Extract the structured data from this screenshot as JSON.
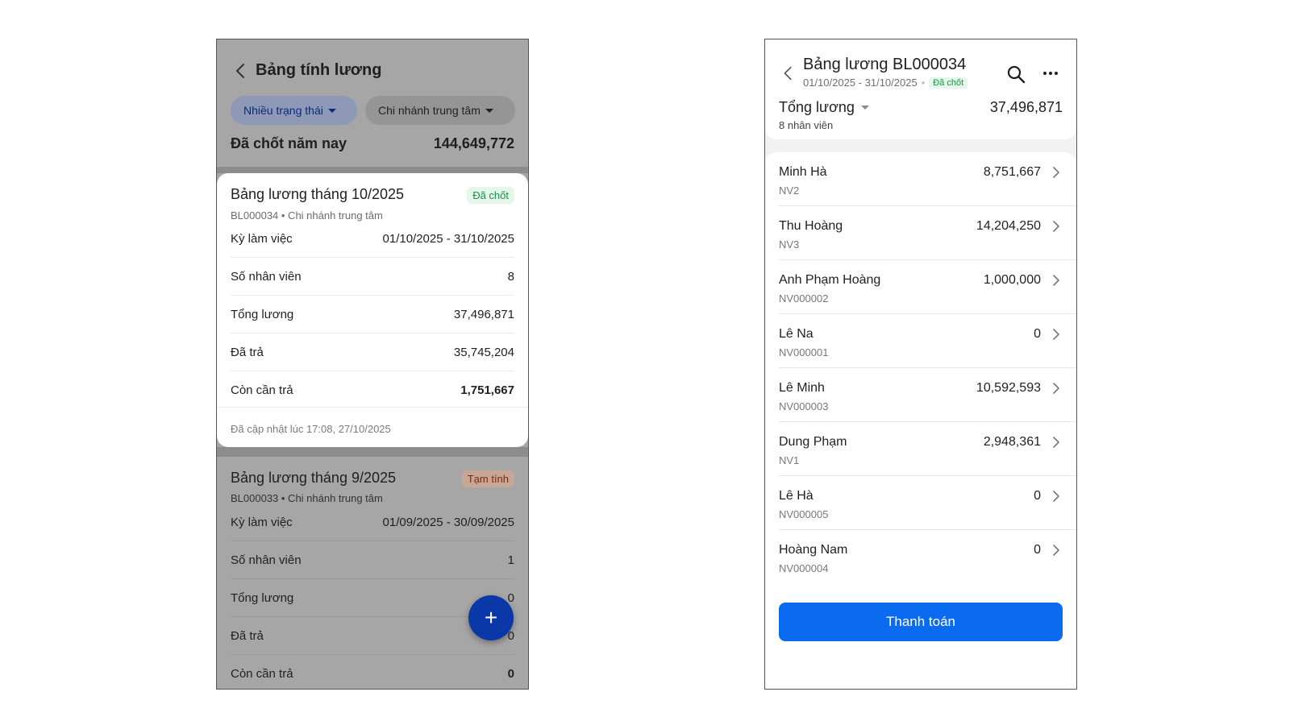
{
  "left": {
    "title": "Bảng tính lương",
    "filters": {
      "status_label": "Nhiều trạng thái",
      "branch_label": "Chi nhánh trung tâm"
    },
    "summary": {
      "label": "Đã chốt năm nay",
      "value": "144,649,772"
    },
    "cards": [
      {
        "title": "Bảng lương tháng 10/2025",
        "badge": "Đã chốt",
        "subtitle": "BL000034 • Chi nhánh trung tâm",
        "rows": [
          {
            "label": "Kỳ làm việc",
            "value": "01/10/2025 - 31/10/2025"
          },
          {
            "label": "Số nhân viên",
            "value": "8"
          },
          {
            "label": "Tổng lương",
            "value": "37,496,871"
          },
          {
            "label": "Đã trả",
            "value": "35,745,204"
          },
          {
            "label": "Còn cần trả",
            "value": "1,751,667"
          }
        ],
        "footer": "Đã cập nhật lúc 17:08, 27/10/2025"
      },
      {
        "title": "Bảng lương tháng 9/2025",
        "badge": "Tạm tính",
        "subtitle": "BL000033 • Chi nhánh trung tâm",
        "rows": [
          {
            "label": "Kỳ làm việc",
            "value": "01/09/2025 - 30/09/2025"
          },
          {
            "label": "Số nhân viên",
            "value": "1"
          },
          {
            "label": "Tổng lương",
            "value": "0"
          },
          {
            "label": "Đã trả",
            "value": "0"
          },
          {
            "label": "Còn cần trả",
            "value": "0"
          }
        ]
      }
    ],
    "fab_label": "+"
  },
  "right": {
    "title": "Bảng lương BL000034",
    "range": "01/10/2025 - 31/10/2025",
    "range_dot": "•",
    "badge": "Đã chốt",
    "total_label": "Tổng lương",
    "total_value": "37,496,871",
    "employee_count": "8 nhân viên",
    "employees": [
      {
        "name": "Minh Hà",
        "code": "NV2",
        "amount": "8,751,667"
      },
      {
        "name": "Thu Hoàng",
        "code": "NV3",
        "amount": "14,204,250"
      },
      {
        "name": "Anh Phạm Hoàng",
        "code": "NV000002",
        "amount": "1,000,000"
      },
      {
        "name": "Lê Na",
        "code": "NV000001",
        "amount": "0"
      },
      {
        "name": "Lê Minh",
        "code": "NV000003",
        "amount": "10,592,593"
      },
      {
        "name": "Dung Phạm",
        "code": "NV1",
        "amount": "2,948,361"
      },
      {
        "name": "Lê Hà",
        "code": "NV000005",
        "amount": "0"
      },
      {
        "name": "Hoàng Nam",
        "code": "NV000004",
        "amount": "0"
      }
    ],
    "pay_button": "Thanh toán"
  },
  "icons": {
    "back": "chevron-left-icon",
    "search": "search-icon",
    "more": "more-horizontal-icon",
    "chevron": "chevron-right-icon",
    "add": "plus-icon"
  },
  "colors": {
    "primary": "#0b6bf0",
    "fab": "#0a38a8",
    "badge_done_bg": "#e5f6ea",
    "badge_done_text": "#18924a",
    "badge_temp_bg": "#c8a695",
    "badge_temp_text": "#7a2a10"
  }
}
